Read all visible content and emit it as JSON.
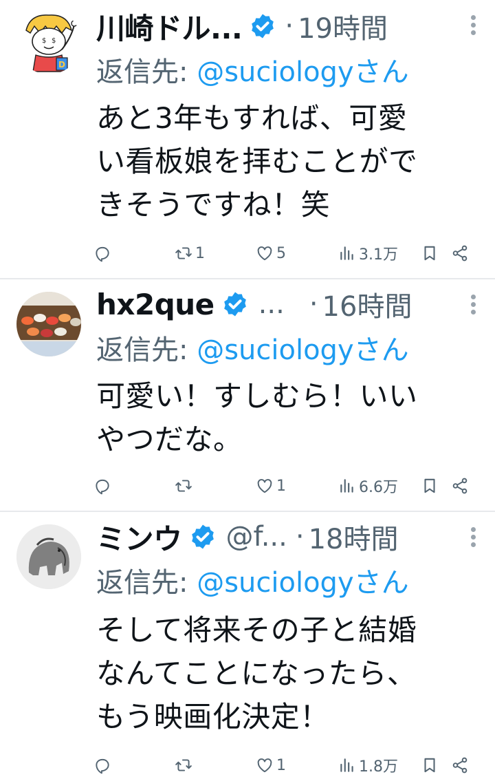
{
  "tweets": [
    {
      "name": "川崎ドル...",
      "handle": "",
      "dot": "·",
      "time": "19時間",
      "reply_prefix": "返信先: ",
      "reply_to": "@suciologyさん",
      "text": "あと3年もすれば、可愛\nい看板娘を拝むことがで\nきそうですね！笑",
      "retweets": "1",
      "likes": "5",
      "views": "3.1万"
    },
    {
      "name": "hx2que",
      "handle": "...",
      "dot": "·",
      "time": "16時間",
      "reply_prefix": "返信先: ",
      "reply_to": "@suciologyさん",
      "text": "可愛い！すしむら！いい\nやつだな。",
      "retweets": "",
      "likes": "1",
      "views": "6.6万"
    },
    {
      "name": "ミンウ",
      "handle": "@f...",
      "dot": "·",
      "time": "18時間",
      "reply_prefix": "返信先: ",
      "reply_to": "@suciologyさん",
      "text": "そして将来その子と結婚\nなんてことになったら、\nもう映画化決定！",
      "retweets": "",
      "likes": "1",
      "views": "1.8万"
    }
  ],
  "colors": {
    "verified": "#1d9bf0",
    "secondary": "#536471",
    "link": "#1d9bf0"
  },
  "icons": [
    "reply-icon",
    "retweet-icon",
    "like-icon",
    "views-icon",
    "bookmark-icon",
    "share-icon",
    "verified-badge-icon",
    "more-icon"
  ]
}
